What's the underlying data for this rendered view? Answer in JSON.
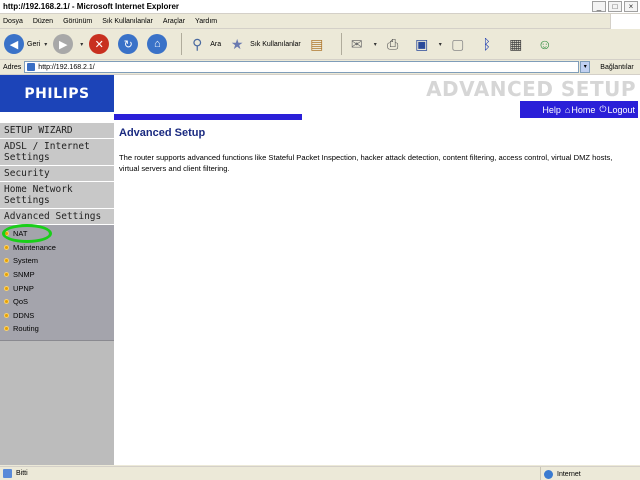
{
  "window": {
    "title": "http://192.168.2.1/ - Microsoft Internet Explorer",
    "minimize": "_",
    "maximize": "□",
    "close": "×"
  },
  "menu": [
    "Dosya",
    "Düzen",
    "Görünüm",
    "Sık Kullanılanlar",
    "Araçlar",
    "Yardım"
  ],
  "toolbar": {
    "back_label": "Geri",
    "search_label": "Ara",
    "favorites_label": "Sık Kullanılanlar"
  },
  "address": {
    "label": "Adres",
    "url": "http://192.168.2.1/",
    "links_label": "Bağlantılar"
  },
  "router": {
    "logo": "PHILIPS",
    "banner_title": "ADVANCED SETUP",
    "nav": {
      "help": "Help",
      "home": "Home",
      "logout": "Logout"
    },
    "sidebar": {
      "headers": [
        "SETUP WIZARD",
        "ADSL / Internet Settings",
        "Security",
        "Home Network Settings",
        "Advanced Settings"
      ],
      "advanced_items": [
        "NAT",
        "Maintenance",
        "System",
        "SNMP",
        "UPNP",
        "QoS",
        "DDNS",
        "Routing"
      ]
    },
    "content": {
      "heading": "Advanced Setup",
      "description": "The router supports advanced functions like Stateful Packet Inspection, hacker attack detection, content filtering, access control, virtual DMZ hosts, virtual servers and client filtering."
    }
  },
  "status": {
    "text": "Bitti",
    "zone": "Internet"
  },
  "colors": {
    "logo_bg": "#1c44b8",
    "nav_bg": "#2a1fd8",
    "heading": "#1a2a80",
    "highlight_circle": "#19ce19"
  }
}
